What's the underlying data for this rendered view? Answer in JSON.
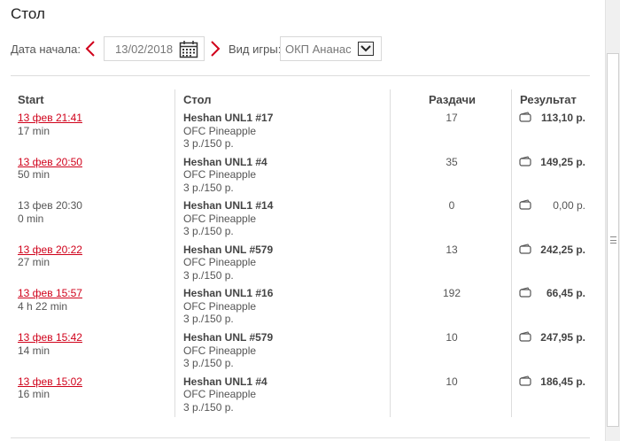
{
  "title": "Стол",
  "filters": {
    "date_label": "Дата начала:",
    "date_value": "13/02/2018",
    "game_label": "Вид игры:",
    "game_value": "ОКП Ананас"
  },
  "columns": {
    "start": "Start",
    "table": "Стол",
    "hands": "Раздачи",
    "result": "Результат"
  },
  "colors": {
    "link": "#d0021b",
    "arrow": "#d0021b"
  },
  "rows": [
    {
      "start": "13 фев 21:41",
      "start_link": true,
      "duration": "17 min",
      "table": "Heshan UNL1 #17",
      "game": "OFC Pineapple",
      "stakes": "3 р./150 р.",
      "hands": "17",
      "result": "113,10 р.",
      "zero": false
    },
    {
      "start": "13 фев 20:50",
      "start_link": true,
      "duration": "50 min",
      "table": "Heshan UNL1 #4",
      "game": "OFC Pineapple",
      "stakes": "3 р./150 р.",
      "hands": "35",
      "result": "149,25 р.",
      "zero": false
    },
    {
      "start": "13 фев 20:30",
      "start_link": false,
      "duration": "0 min",
      "table": "Heshan UNL1 #14",
      "game": "OFC Pineapple",
      "stakes": "3 р./150 р.",
      "hands": "0",
      "result": "0,00 р.",
      "zero": true
    },
    {
      "start": "13 фев 20:22",
      "start_link": true,
      "duration": "27 min",
      "table": "Heshan UNL #579",
      "game": "OFC Pineapple",
      "stakes": "3 р./150 р.",
      "hands": "13",
      "result": "242,25 р.",
      "zero": false
    },
    {
      "start": "13 фев 15:57",
      "start_link": true,
      "duration": "4 h 22 min",
      "table": "Heshan UNL1 #16",
      "game": "OFC Pineapple",
      "stakes": "3 р./150 р.",
      "hands": "192",
      "result": "66,45 р.",
      "zero": false
    },
    {
      "start": "13 фев 15:42",
      "start_link": true,
      "duration": "14 min",
      "table": "Heshan UNL #579",
      "game": "OFC Pineapple",
      "stakes": "3 р./150 р.",
      "hands": "10",
      "result": "247,95 р.",
      "zero": false
    },
    {
      "start": "13 фев 15:02",
      "start_link": true,
      "duration": "16 min",
      "table": "Heshan UNL1 #4",
      "game": "OFC Pineapple",
      "stakes": "3 р./150 р.",
      "hands": "10",
      "result": "186,45 р.",
      "zero": false
    }
  ]
}
